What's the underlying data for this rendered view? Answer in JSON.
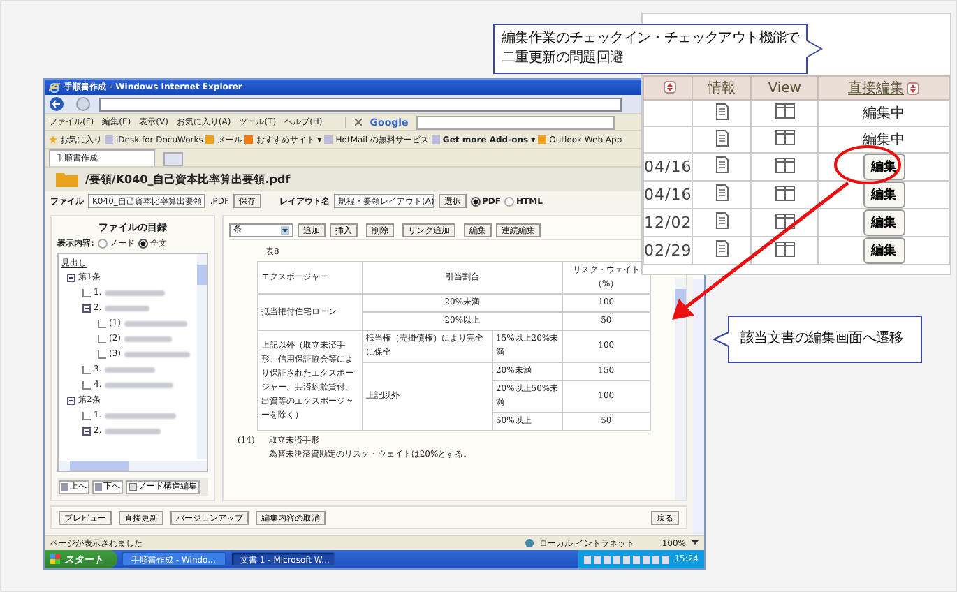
{
  "list_panel": {
    "columns": [
      {
        "kind": "sort-only"
      },
      {
        "label": "情報",
        "kind": "plain"
      },
      {
        "label": "View",
        "kind": "plain"
      },
      {
        "label": "直接編集",
        "kind": "sort"
      }
    ],
    "rows": [
      {
        "edit": {
          "kind": "status",
          "text": "編集中"
        }
      },
      {
        "edit": {
          "kind": "status",
          "text": "編集中"
        }
      },
      {
        "date": "04/16",
        "edit": {
          "kind": "button",
          "text": "編集"
        }
      },
      {
        "date": "04/16",
        "edit": {
          "kind": "button",
          "text": "編集"
        }
      },
      {
        "date": "12/02",
        "edit": {
          "kind": "button",
          "text": "編集"
        }
      },
      {
        "date": "02/29",
        "edit": {
          "kind": "button",
          "text": "編集"
        }
      }
    ]
  },
  "browser": {
    "title": "手順書作成 - Windows Internet Explorer",
    "menu": [
      "ファイル(F)",
      "編集(E)",
      "表示(V)",
      "お気に入り(A)",
      "ツール(T)",
      "ヘルプ(H)"
    ],
    "search_engine": "Google",
    "favorites": [
      {
        "label": "お気に入り",
        "kind": "star"
      },
      {
        "label": "iDesk for DocuWorks",
        "kind": "page"
      },
      {
        "label": "メール",
        "kind": "mail"
      },
      {
        "label": "おすすめサイト ▾",
        "kind": "site"
      },
      {
        "label": "HotMail の無料サービス",
        "kind": "page"
      },
      {
        "label": "Get more Add-ons ▾",
        "kind": "page"
      },
      {
        "label": "Outlook Web App",
        "kind": "mail"
      }
    ],
    "tab": "手順書作成",
    "page": {
      "path": "/要領/K040_自己資本比率算出要領.pdf",
      "file_label": "ファイル",
      "file_name": "K040_自己資本比率算出要領",
      "file_ext": ".PDF",
      "save": "保存",
      "layout_label": "レイアウト名",
      "layout_value": "規程・要領レイアウト(A)",
      "select": "選択",
      "formats": [
        {
          "label": "PDF",
          "selected": true
        },
        {
          "label": "HTML",
          "selected": false
        }
      ],
      "outline": {
        "title": "ファイルの目録",
        "view_label": "表示内容:",
        "view_options": [
          {
            "label": "ノード",
            "selected": false
          },
          {
            "label": "全文",
            "selected": true
          }
        ],
        "heading": "見出し",
        "tree": [
          {
            "label": "第1条",
            "expanded": true,
            "children": [
              {
                "label": "1.",
                "expanded": false
              },
              {
                "label": "2.",
                "expanded": true,
                "children": [
                  {
                    "label": "(1)",
                    "expanded": false
                  },
                  {
                    "label": "(2)",
                    "expanded": false
                  },
                  {
                    "label": "(3)",
                    "expanded": false
                  }
                ]
              },
              {
                "label": "3.",
                "expanded": false
              },
              {
                "label": "4.",
                "expanded": false
              }
            ]
          },
          {
            "label": "第2条",
            "expanded": true,
            "children": [
              {
                "label": "1.",
                "expanded": false
              },
              {
                "label": "2.",
                "expanded": true
              }
            ]
          }
        ],
        "buttons": [
          {
            "label": "上へ",
            "kind": "up"
          },
          {
            "label": "下へ",
            "kind": "down"
          },
          {
            "label": "ノード構造編集",
            "kind": "tree"
          }
        ]
      },
      "toolbar": {
        "level_select": "条",
        "buttons": [
          "追加",
          "挿入",
          "削除",
          "リンク追加",
          "編集",
          "連続編集"
        ]
      },
      "caption": "表8",
      "table": [
        [
          {
            "text": "エクスポージャー"
          },
          {
            "text": "引当割合",
            "colspan": 2
          },
          {
            "text": "リスク・ウェイト（%）"
          }
        ],
        [
          {
            "text": "抵当権付住宅ローン",
            "rowspan": 2
          },
          {
            "text": "20%未満",
            "colspan": 2
          },
          {
            "text": "100"
          }
        ],
        [
          {
            "text": "20%以上",
            "colspan": 2
          },
          {
            "text": "50"
          }
        ],
        [
          {
            "text": "上記以外（取立未済手形、信用保証協会等により保証されたエクスポージャー、共済約款貸付、出資等のエクスポージャーを除く）",
            "rowspan": 4
          },
          {
            "text": "抵当権（売掛債権）により完全に保全"
          },
          {
            "text": "15%以上20%未満"
          },
          {
            "text": "100"
          }
        ],
        [
          {
            "text": "上記以外",
            "rowspan": 3
          },
          {
            "text": "20%未満"
          },
          {
            "text": "150"
          }
        ],
        [
          {
            "text": "20%以上50%未満"
          },
          {
            "text": "100"
          }
        ],
        [
          {
            "text": "50%以上"
          },
          {
            "text": "50"
          }
        ]
      ],
      "items": [
        {
          "number": "(14)",
          "title": "取立未済手形",
          "body": "為替未決済資勘定のリスク・ウェイトは20%とする。"
        }
      ],
      "actions": [
        "プレビュー",
        "直接更新",
        "バージョンアップ",
        "編集内容の取消"
      ],
      "back": "戻る"
    },
    "status_text": "ページが表示されました",
    "zone": "ローカル イントラネット",
    "zoom": "100%"
  },
  "taskbar": {
    "start": "スタート",
    "tasks": [
      {
        "label": "手順書作成 - Windo...",
        "selected": false
      },
      {
        "label": "文書 1 - Microsoft W...",
        "selected": true
      }
    ],
    "clock": "15:24"
  },
  "callouts": [
    {
      "lines": [
        "編集作業のチェックイン・チェックアウト機能で",
        "二重更新の問題回避"
      ]
    },
    {
      "lines": [
        "該当文書の編集画面へ遷移"
      ]
    }
  ]
}
